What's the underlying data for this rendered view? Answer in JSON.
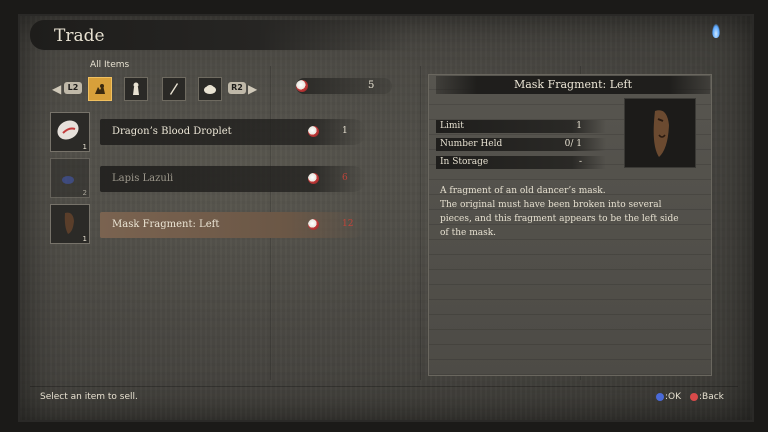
{
  "header": {
    "title": "Trade"
  },
  "categories": {
    "label": "All Items",
    "left_button": "L2",
    "right_button": "R2",
    "icons": [
      "all-items-icon",
      "consumable-icon",
      "prosthetic-icon",
      "material-icon"
    ]
  },
  "currency": {
    "amount": "5"
  },
  "items": [
    {
      "name": "Dragon’s Blood Droplet",
      "qty": "1",
      "price": "1",
      "state": "affordable"
    },
    {
      "name": "Lapis Lazuli",
      "qty": "2",
      "price": "6",
      "state": "unaffordable"
    },
    {
      "name": "Mask Fragment: Left",
      "qty": "1",
      "price": "12",
      "state": "selected-unaffordable"
    }
  ],
  "detail": {
    "title": "Mask Fragment: Left",
    "stats": [
      {
        "label": "Limit",
        "value": "1"
      },
      {
        "label": "Number Held",
        "value": "0/  1"
      },
      {
        "label": "In Storage",
        "value": "-"
      }
    ],
    "description": [
      "A fragment of an old dancer’s mask.",
      "The original must have been broken into several",
      "pieces, and this fragment appears to be the left side",
      "of the mask."
    ]
  },
  "footer": {
    "help": "Select an item to sell.",
    "ok_hint": ":OK",
    "back_hint": ":Back"
  },
  "colors": {
    "accent": "#d8a03a",
    "price_unaffordable": "#c0443a",
    "ok_button": "#4a6ad8",
    "back_button": "#d84a4a"
  }
}
